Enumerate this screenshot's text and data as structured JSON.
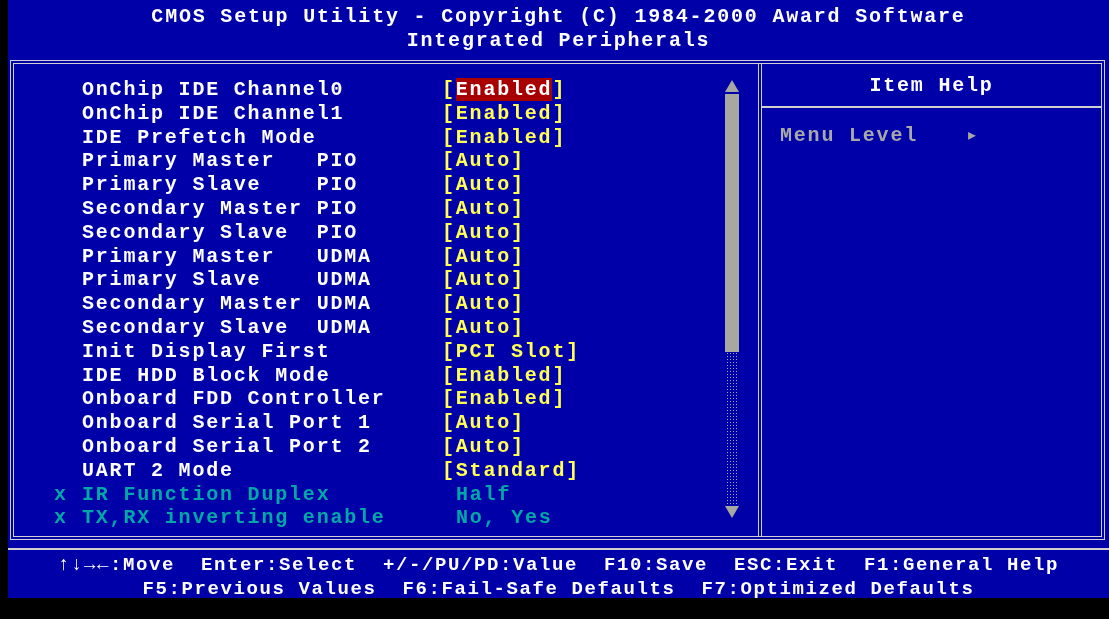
{
  "header": {
    "title": "CMOS Setup Utility - Copyright (C) 1984-2000 Award Software",
    "subtitle": "Integrated Peripherals"
  },
  "settings": [
    {
      "label": "OnChip IDE Channel0",
      "value": "Enabled",
      "brackets": [
        "[",
        "]"
      ],
      "selected": true,
      "disabled": false
    },
    {
      "label": "OnChip IDE Channel1",
      "value": "Enabled",
      "brackets": [
        "[",
        "]"
      ],
      "selected": false,
      "disabled": false
    },
    {
      "label": "IDE Prefetch Mode",
      "value": "Enabled",
      "brackets": [
        "[",
        "]"
      ],
      "selected": false,
      "disabled": false
    },
    {
      "label": "Primary Master   PIO",
      "value": "Auto",
      "brackets": [
        "[",
        "]"
      ],
      "selected": false,
      "disabled": false
    },
    {
      "label": "Primary Slave    PIO",
      "value": "Auto",
      "brackets": [
        "[",
        "]"
      ],
      "selected": false,
      "disabled": false
    },
    {
      "label": "Secondary Master PIO",
      "value": "Auto",
      "brackets": [
        "[",
        "]"
      ],
      "selected": false,
      "disabled": false
    },
    {
      "label": "Secondary Slave  PIO",
      "value": "Auto",
      "brackets": [
        "[",
        "]"
      ],
      "selected": false,
      "disabled": false
    },
    {
      "label": "Primary Master   UDMA",
      "value": "Auto",
      "brackets": [
        "[",
        "]"
      ],
      "selected": false,
      "disabled": false
    },
    {
      "label": "Primary Slave    UDMA",
      "value": "Auto",
      "brackets": [
        "[",
        "]"
      ],
      "selected": false,
      "disabled": false
    },
    {
      "label": "Secondary Master UDMA",
      "value": "Auto",
      "brackets": [
        "[",
        "]"
      ],
      "selected": false,
      "disabled": false
    },
    {
      "label": "Secondary Slave  UDMA",
      "value": "Auto",
      "brackets": [
        "[",
        "]"
      ],
      "selected": false,
      "disabled": false
    },
    {
      "label": "Init Display First",
      "value": "PCI Slot",
      "brackets": [
        "[",
        "]"
      ],
      "selected": false,
      "disabled": false
    },
    {
      "label": "IDE HDD Block Mode",
      "value": "Enabled",
      "brackets": [
        "[",
        "]"
      ],
      "selected": false,
      "disabled": false
    },
    {
      "label": "Onboard FDD Controller",
      "value": "Enabled",
      "brackets": [
        "[",
        "]"
      ],
      "selected": false,
      "disabled": false
    },
    {
      "label": "Onboard Serial Port 1",
      "value": "Auto",
      "brackets": [
        "[",
        "]"
      ],
      "selected": false,
      "disabled": false
    },
    {
      "label": "Onboard Serial Port 2",
      "value": "Auto",
      "brackets": [
        "[",
        "]"
      ],
      "selected": false,
      "disabled": false
    },
    {
      "label": "UART 2 Mode",
      "value": "Standard",
      "brackets": [
        "[",
        "]"
      ],
      "selected": false,
      "disabled": false
    },
    {
      "prefix": "x",
      "label": "IR Function Duplex",
      "value": "Half",
      "selected": false,
      "disabled": true
    },
    {
      "prefix": "x",
      "label": "TX,RX inverting enable",
      "value": "No, Yes",
      "selected": false,
      "disabled": true
    }
  ],
  "help": {
    "title": "Item Help",
    "menu_level": "Menu Level",
    "arrow": "▸"
  },
  "footer": [
    [
      "↑↓→←:Move",
      "Enter:Select",
      "+/-/PU/PD:Value",
      "F10:Save",
      "ESC:Exit",
      "F1:General Help"
    ],
    [
      "F5:Previous Values",
      "F6:Fail-Safe Defaults",
      "F7:Optimized Defaults"
    ]
  ]
}
